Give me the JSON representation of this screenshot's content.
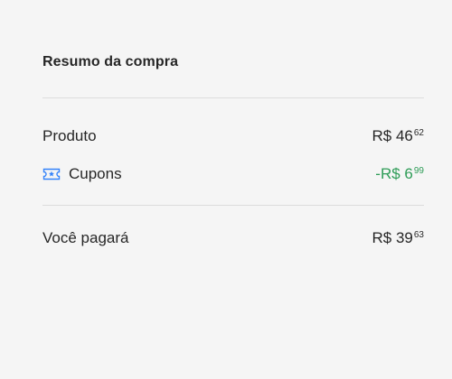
{
  "summary": {
    "title": "Resumo da compra",
    "product": {
      "label": "Produto",
      "amount_main": "R$ 46",
      "amount_cents": "62"
    },
    "coupons": {
      "icon": "ticket-icon",
      "label": "Cupons",
      "amount_main": "-R$ 6",
      "amount_cents": "99",
      "color": "#2e9c57"
    },
    "total": {
      "label": "Você pagará",
      "amount_main": "R$ 39",
      "amount_cents": "63"
    }
  },
  "colors": {
    "background": "#f5f5f5",
    "divider": "#dcdcdc",
    "accent_icon": "#3483fa",
    "discount": "#2e9c57"
  }
}
